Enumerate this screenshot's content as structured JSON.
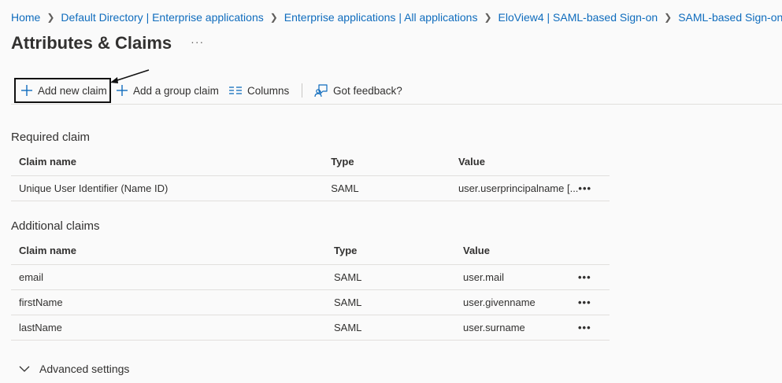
{
  "breadcrumb": [
    {
      "label": "Home"
    },
    {
      "label": "Default Directory | Enterprise applications"
    },
    {
      "label": "Enterprise applications | All applications"
    },
    {
      "label": "EloView4 | SAML-based Sign-on"
    },
    {
      "label": "SAML-based Sign-on"
    }
  ],
  "page": {
    "title": "Attributes & Claims",
    "more_label": "···"
  },
  "toolbar": {
    "add_new_claim": "Add new claim",
    "add_group_claim": "Add a group claim",
    "columns": "Columns",
    "feedback": "Got feedback?"
  },
  "required": {
    "section_title": "Required claim",
    "columns": [
      "Claim name",
      "Type",
      "Value"
    ],
    "rows": [
      {
        "name": "Unique User Identifier (Name ID)",
        "type": "SAML",
        "value": "user.userprincipalname [..."
      }
    ]
  },
  "additional": {
    "section_title": "Additional claims",
    "columns": [
      "Claim name",
      "Type",
      "Value"
    ],
    "rows": [
      {
        "name": "email",
        "type": "SAML",
        "value": "user.mail"
      },
      {
        "name": "firstName",
        "type": "SAML",
        "value": "user.givenname"
      },
      {
        "name": "lastName",
        "type": "SAML",
        "value": "user.surname"
      }
    ]
  },
  "row_more_label": "•••",
  "advanced_settings": "Advanced settings",
  "colors": {
    "link": "#0f6cbd",
    "accent_icon": "#0f6cbd",
    "text": "#323130",
    "background": "#fafafa",
    "border": "#e1dfdd",
    "highlight_box": "#111111"
  },
  "icons": {
    "add": "plus-icon",
    "group": "plus-icon",
    "columns": "columns-icon",
    "feedback": "feedback-icon",
    "separator": "chevron-right-icon",
    "expand": "chevron-down-icon",
    "more": "ellipsis-icon"
  }
}
